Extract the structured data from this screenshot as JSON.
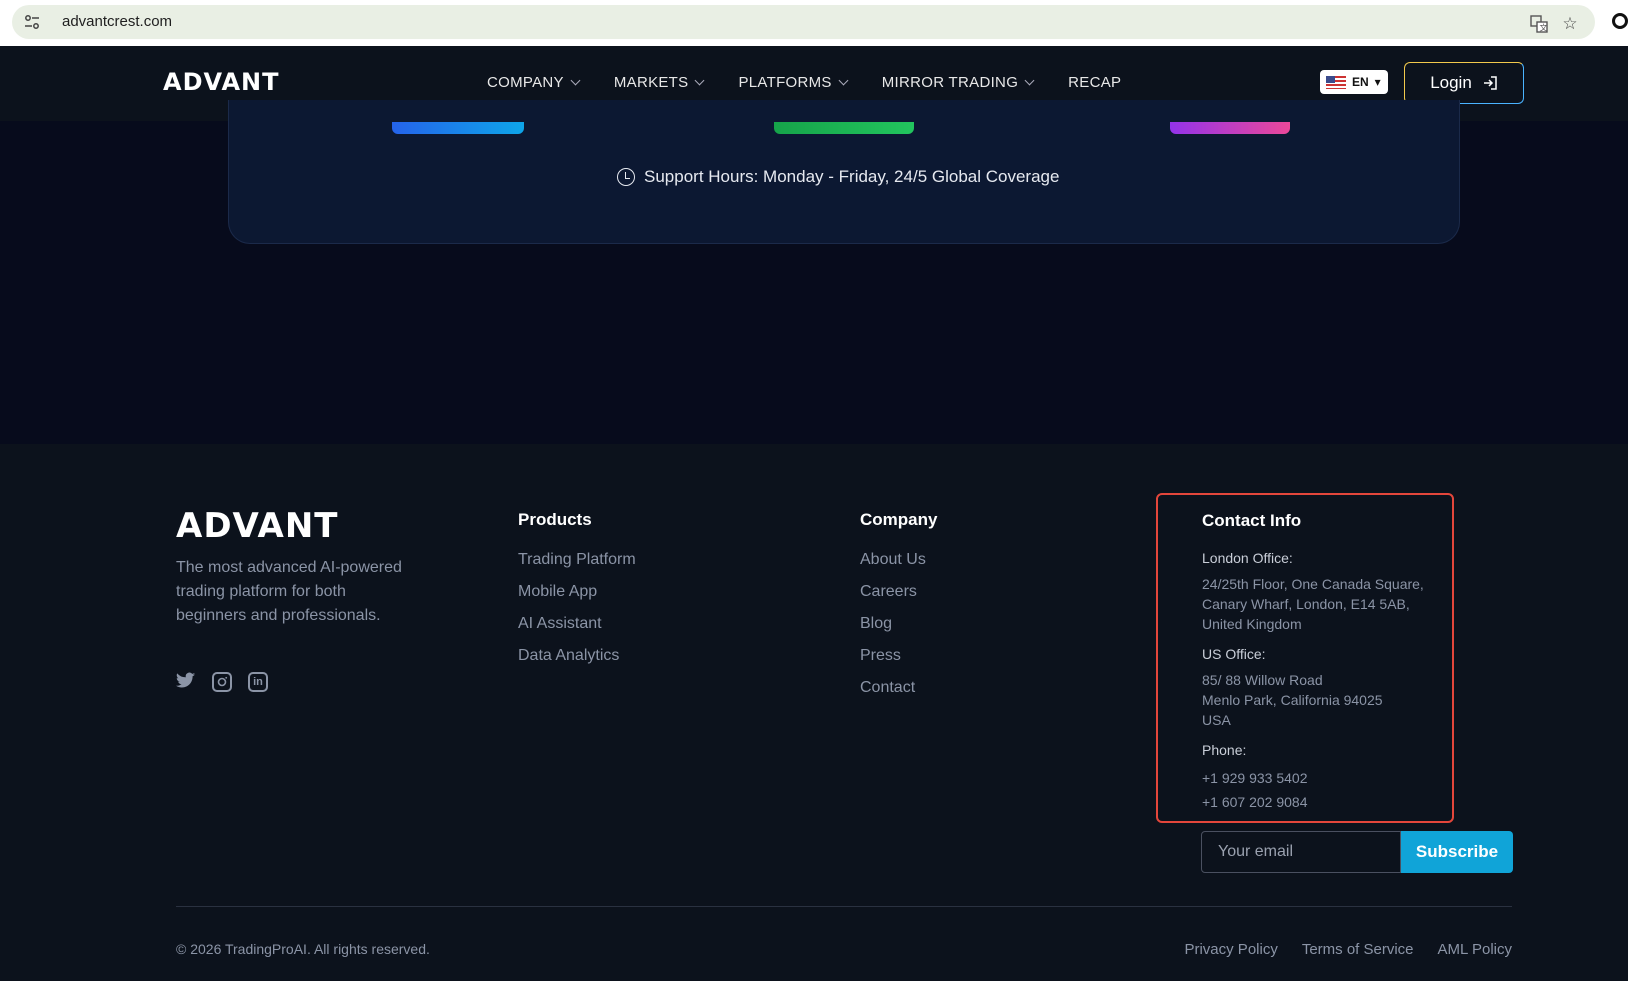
{
  "browser": {
    "url": "advantcrest.com",
    "icons": [
      "tune-icon",
      "translate-icon",
      "star-icon"
    ]
  },
  "nav": {
    "logo_text": "ADVANT",
    "menu": [
      {
        "label": "COMPANY",
        "has_dropdown": true
      },
      {
        "label": "MARKETS",
        "has_dropdown": true
      },
      {
        "label": "PLATFORMS",
        "has_dropdown": true
      },
      {
        "label": "MIRROR TRADING",
        "has_dropdown": true
      },
      {
        "label": "RECAP",
        "has_dropdown": false
      }
    ],
    "language": "EN",
    "login_label": "Login"
  },
  "support": {
    "hours_text": "Support Hours: Monday - Friday, 24/5 Global Coverage",
    "button_gradients": [
      {
        "from": "#2563eb",
        "to": "#0ea5e9"
      },
      {
        "from": "#16a34a",
        "to": "#22c55e"
      },
      {
        "from": "#9333ea",
        "to": "#ec4899"
      }
    ]
  },
  "footer": {
    "logo_text": "ADVANT",
    "tagline": "The most advanced AI-powered trading platform for both beginners and professionals.",
    "socials": [
      "twitter-icon",
      "instagram-icon",
      "linkedin-icon"
    ],
    "products": {
      "heading": "Products",
      "links": [
        "Trading Platform",
        "Mobile App",
        "AI Assistant",
        "Data Analytics"
      ]
    },
    "company": {
      "heading": "Company",
      "links": [
        "About Us",
        "Careers",
        "Blog",
        "Press",
        "Contact"
      ]
    },
    "contact": {
      "heading": "Contact Info",
      "london_label": "London Office:",
      "london_lines": [
        "24/25th Floor, One Canada Square,",
        "Canary Wharf, London, E14 5AB,",
        "United Kingdom"
      ],
      "us_label": "US Office:",
      "us_lines": [
        "85/ 88 Willow Road",
        "Menlo Park, California 94025",
        "USA"
      ],
      "phone_label": "Phone:",
      "phones": [
        "+1 929 933 5402",
        "+1 607 202 9084"
      ]
    },
    "subscribe": {
      "placeholder": "Your email",
      "button_label": "Subscribe"
    },
    "copyright": "© 2026 TradingProAI. All rights reserved.",
    "legal_links": [
      "Privacy Policy",
      "Terms of Service",
      "AML Policy"
    ]
  },
  "colors": {
    "accent": "#10a4d8",
    "highlight_border": "#e4463b",
    "page_bg": "#070b1c",
    "footer_bg": "#0c121c"
  }
}
